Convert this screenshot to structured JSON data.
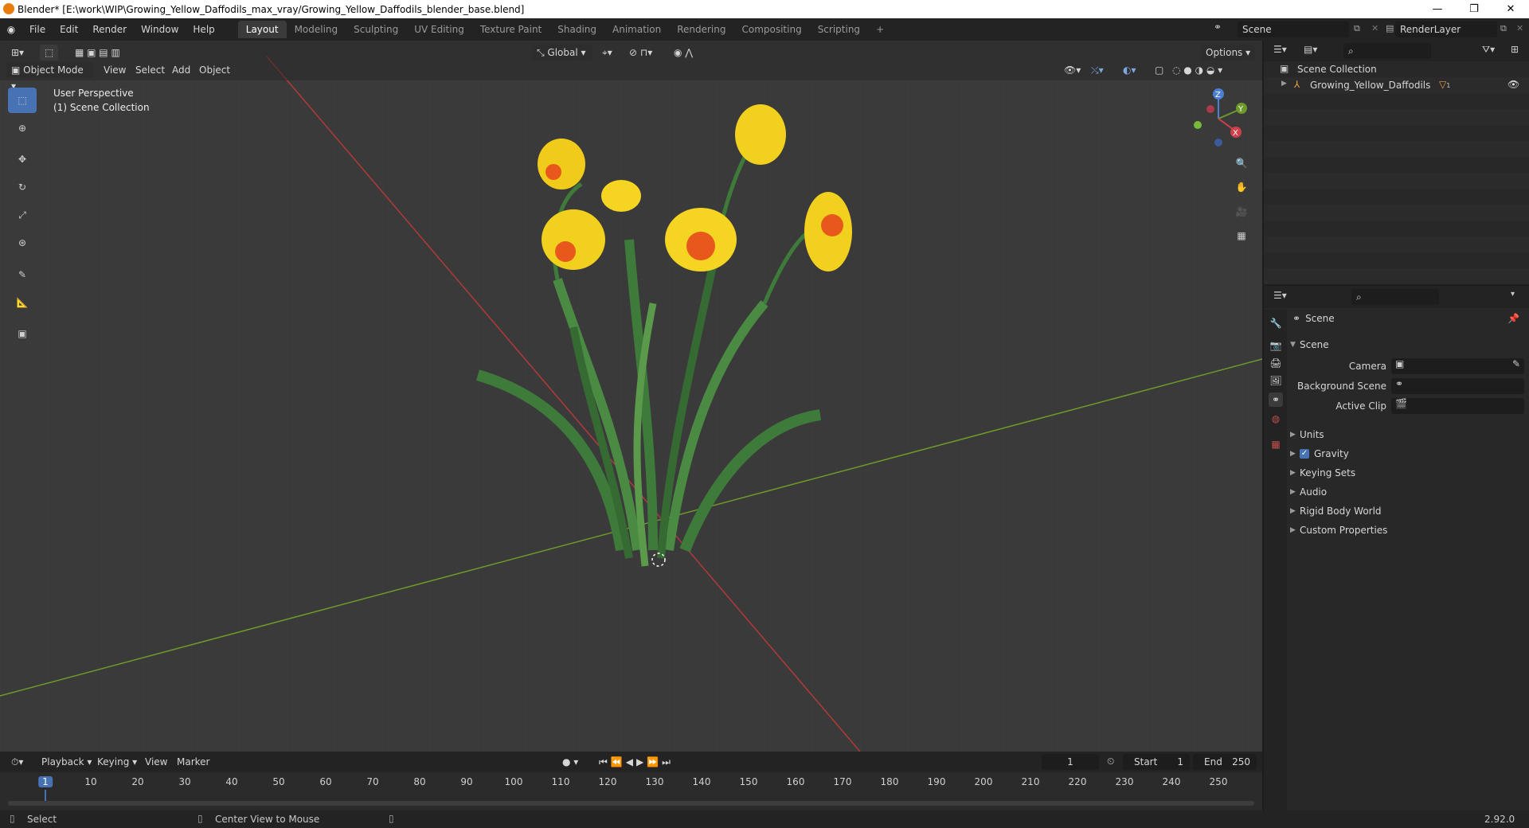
{
  "window": {
    "title": "Blender* [E:\\work\\WIP\\Growing_Yellow_Daffodils_max_vray/Growing_Yellow_Daffodils_blender_base.blend]",
    "minimize": "—",
    "maximize": "❐",
    "close": "✕"
  },
  "menu": {
    "items": [
      "File",
      "Edit",
      "Render",
      "Window",
      "Help"
    ],
    "workspaces": [
      "Layout",
      "Modeling",
      "Sculpting",
      "UV Editing",
      "Texture Paint",
      "Shading",
      "Animation",
      "Rendering",
      "Compositing",
      "Scripting"
    ],
    "add_workspace": "+",
    "scene": "Scene",
    "view_layer": "RenderLayer"
  },
  "viewport": {
    "mode": "Object Mode",
    "menus": [
      "View",
      "Select",
      "Add",
      "Object"
    ],
    "orientation": "Global",
    "options": "Options",
    "overlay_line1": "User Perspective",
    "overlay_line2": "(1) Scene Collection",
    "gizmo": {
      "z": "Z",
      "y": "Y",
      "x": "X"
    }
  },
  "outliner": {
    "root": "Scene Collection",
    "object": "Growing_Yellow_Daffodils",
    "object_badge": "1"
  },
  "properties": {
    "breadcrumb": "Scene",
    "panel_title": "Scene",
    "fields": [
      {
        "label": "Camera"
      },
      {
        "label": "Background Scene"
      },
      {
        "label": "Active Clip"
      }
    ],
    "subpanels": [
      "Units",
      "Gravity",
      "Keying Sets",
      "Audio",
      "Rigid Body World",
      "Custom Properties"
    ],
    "gravity_checked": true
  },
  "timeline": {
    "menus": [
      "Playback",
      "Keying",
      "View",
      "Marker"
    ],
    "current_frame": "1",
    "start_label": "Start",
    "start": "1",
    "end_label": "End",
    "end": "250",
    "ruler": [
      "1",
      "10",
      "20",
      "30",
      "40",
      "50",
      "60",
      "70",
      "80",
      "90",
      "100",
      "110",
      "120",
      "130",
      "140",
      "150",
      "160",
      "170",
      "180",
      "190",
      "200",
      "210",
      "220",
      "230",
      "240",
      "250"
    ]
  },
  "status": {
    "left": "Select",
    "middle": "Center View to Mouse",
    "version": "2.92.0"
  },
  "colors": {
    "accent": "#4772b3",
    "x_axis": "#b03a3a",
    "y_axis": "#6e9a2a",
    "flower": "#f2d01e",
    "trumpet": "#e8581c",
    "leaf": "#3e7a3a"
  }
}
